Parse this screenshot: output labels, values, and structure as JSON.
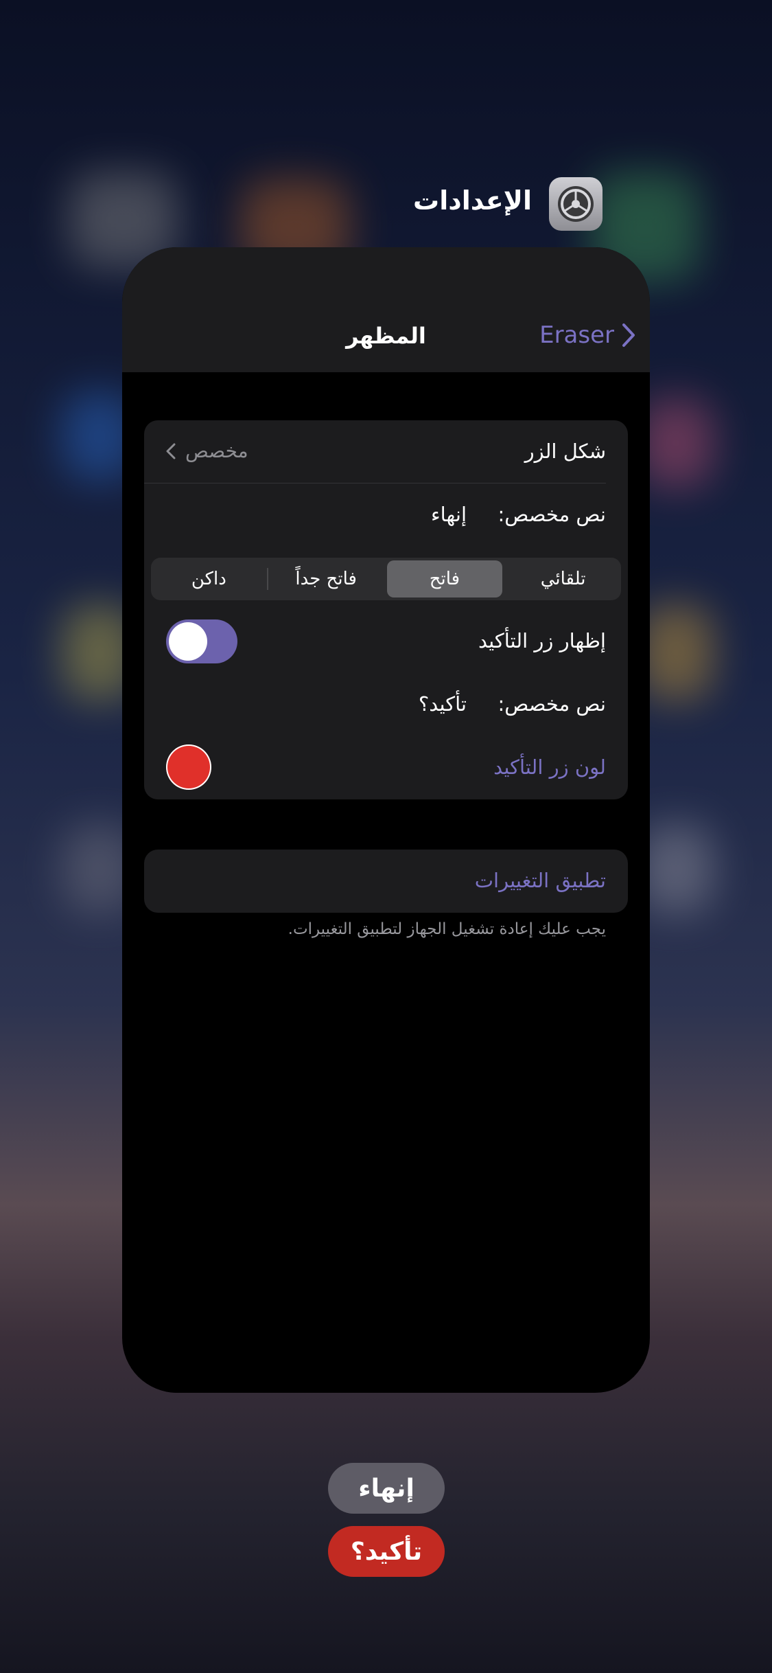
{
  "app_switcher": {
    "app_name": "الإعدادات",
    "app_icon": "settings-gear-icon"
  },
  "nav": {
    "back_label": "Eraser",
    "title": "المظهر"
  },
  "settings": {
    "button_shape": {
      "label": "شكل الزر",
      "value": "مخصص"
    },
    "custom_text_1": {
      "label": "نص مخصص:",
      "value": "إنهاء"
    },
    "segments": [
      "تلقائي",
      "فاتح",
      "فاتح جداً",
      "داكن"
    ],
    "selected_segment": "فاتح",
    "show_confirm": {
      "label": "إظهار زر التأكيد",
      "enabled": true
    },
    "custom_text_2": {
      "label": "نص مخصص:",
      "value": "تأكيد؟"
    },
    "confirm_color": {
      "label": "لون زر التأكيد",
      "color": "#e0302a"
    },
    "apply_button": "تطبيق التغييرات",
    "footnote": "يجب عليك إعادة تشغيل الجهاز لتطبيق التغييرات."
  },
  "floating_buttons": {
    "end_label": "إنهاء",
    "confirm_label": "تأكيد؟"
  },
  "colors": {
    "accent": "#7b72c4",
    "toggle_on": "#6c62ad",
    "confirm_red": "#c22a22",
    "end_gray": "#5e5c66"
  }
}
